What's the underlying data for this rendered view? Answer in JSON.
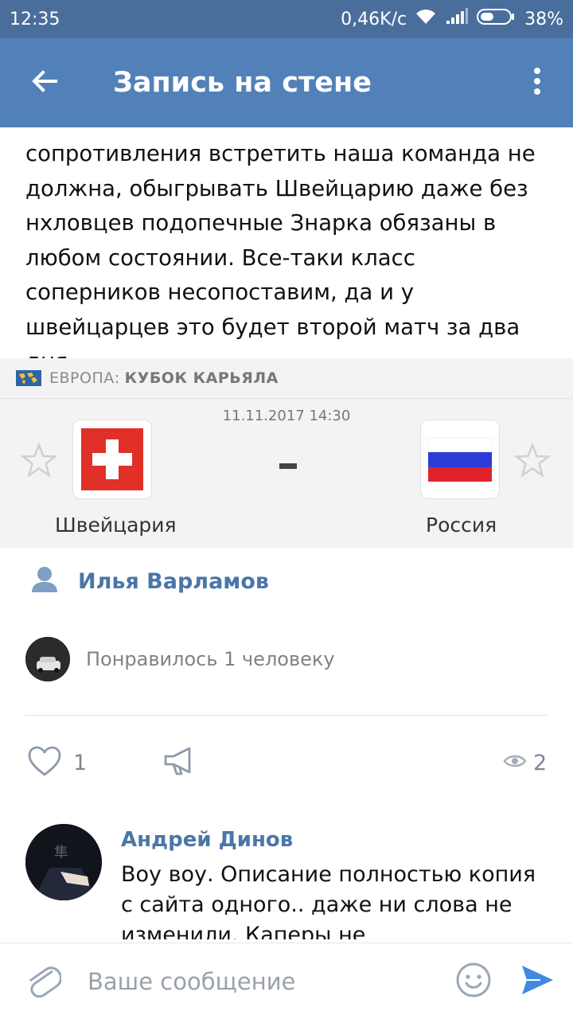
{
  "status_bar": {
    "time": "12:35",
    "speed": "0,46K/c",
    "battery": "38%",
    "icons": [
      "wifi-icon",
      "signal-icon",
      "battery-icon"
    ]
  },
  "app_bar": {
    "title": "Запись на стене",
    "back_icon": "back-arrow-icon",
    "menu_icon": "more-vert-icon"
  },
  "post": {
    "text": "сопротивления встретить наша команда не должна, обыгрывать Швейцарию даже без нхловцев подопечные Знарка обязаны в любом состоянии. Все-таки класс соперников несопоставим, да и у швейцарцев это будет второй матч за два дня."
  },
  "match": {
    "region": "ЕВРОПА:",
    "tournament": "КУБОК КАРЬЯЛА",
    "datetime": "11.11.2017 14:30",
    "home_team": "Швейцария",
    "away_team": "Россия",
    "score": "-"
  },
  "author": {
    "name": "Илья Варламов"
  },
  "likes": {
    "text": "Понравилось 1 человеку"
  },
  "actions": {
    "like_count": "1",
    "views_count": "2"
  },
  "comment": {
    "author": "Андрей Динов",
    "text": "Воу воу. Описание полностью копия с сайта одного.. даже ни слова не изменили. Каперы не"
  },
  "composer": {
    "placeholder": "Ваше сообщение"
  },
  "colors": {
    "header": "#5181b8",
    "status_bar": "#4a6e9c",
    "link": "#4a76a8",
    "send": "#3f8ae0"
  }
}
